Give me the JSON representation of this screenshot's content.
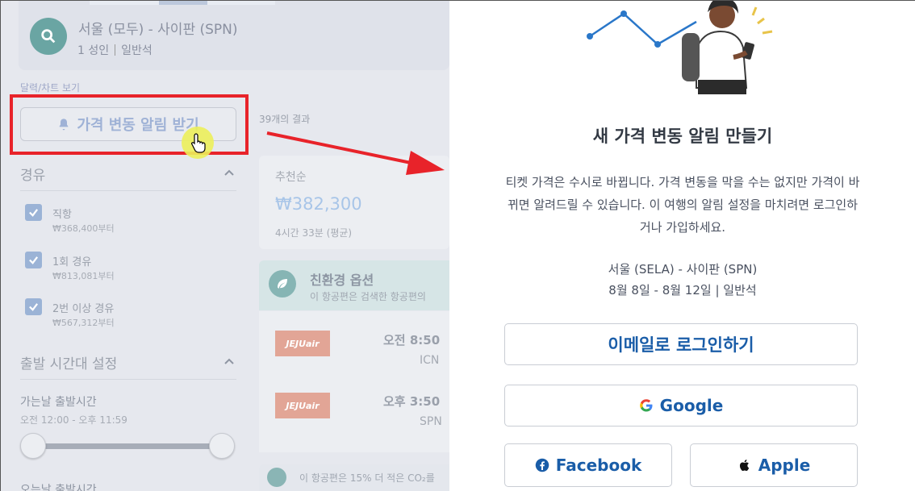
{
  "search": {
    "route": "서울 (모두) - 사이판 (SPN)",
    "passengers": "1 성인",
    "cabin": "일반석"
  },
  "calendar_link": "달력/차트 보기",
  "alert_button": "가격 변동 알림 받기",
  "results_count": "39개의 결과",
  "filters": {
    "stops_heading": "경유",
    "options": [
      {
        "label": "직항",
        "price": "₩368,400부터"
      },
      {
        "label": "1회 경유",
        "price": "₩813,081부터"
      },
      {
        "label": "2번 이상 경유",
        "price": "₩567,312부터"
      }
    ],
    "departure_heading": "출발 시간대 설정",
    "outbound_label": "가는날 출발시간",
    "outbound_range": "오전 12:00 - 오후 11:59",
    "return_label": "오는날 출발시간"
  },
  "sort_card": {
    "label": "추천순",
    "price": "₩382,300",
    "duration": "4시간 33분 (평균)"
  },
  "eco": {
    "title": "친환경 옵션",
    "subtitle": "이 항공편은 검색한 항공편의",
    "bottom_text": "이 항공편은 15% 더 적은 CO₂를"
  },
  "flights": [
    {
      "airline": "JEJUair",
      "time": "오전 8:50",
      "airport": "ICN"
    },
    {
      "airline": "JEJUair",
      "time": "오후 3:50",
      "airport": "SPN"
    }
  ],
  "modal": {
    "title": "새 가격 변동 알림 만들기",
    "description_lines": [
      "티켓 가격은 수시로 바뀝니다. 가격 변동을 막을 수는 없지만 가격이 바",
      "뀌면 알려드릴 수 있습니다. 이 여행의 알림 설정을 마치려면 로그인하",
      "거나 가입하세요."
    ],
    "trip_route": "서울 (SELA) - 사이판 (SPN)",
    "trip_dates": "8월 8일 - 8월 12일 | 일반석",
    "email_button": "이메일로 로그인하기",
    "google_button": "Google",
    "facebook_button": "Facebook",
    "apple_button": "Apple"
  },
  "colors": {
    "highlight_red": "#e8232a",
    "modal_link_blue": "#1a5da8",
    "dim_overlay": "#e6e8ee"
  }
}
